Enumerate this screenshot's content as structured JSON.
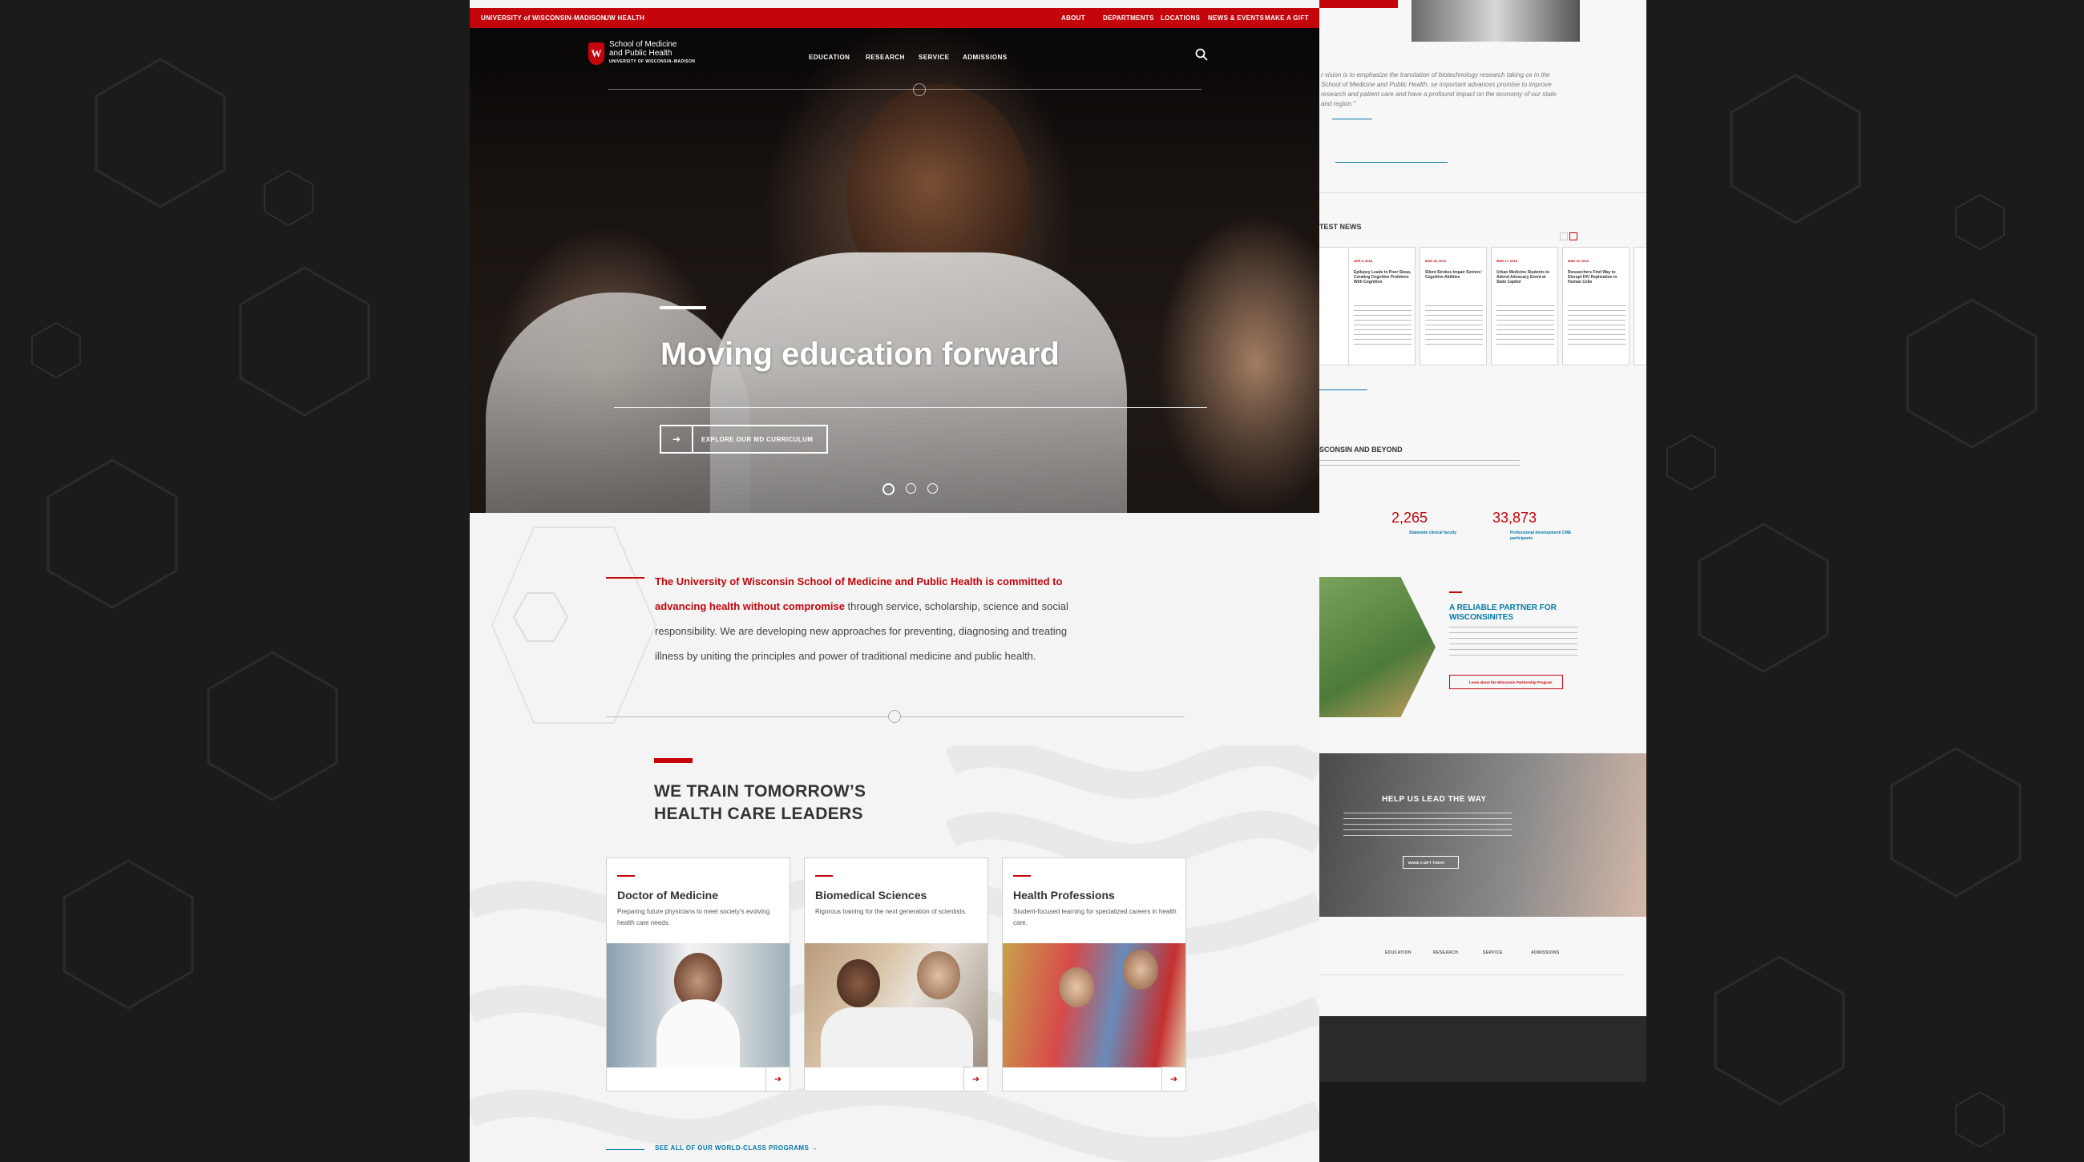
{
  "topbar": {
    "uw_madison": "UNIVERSITY of WISCONSIN-MADISON",
    "uw_health": "UW HEALTH",
    "links": [
      "ABOUT",
      "DEPARTMENTS",
      "LOCATIONS",
      "NEWS & EVENTS",
      "MAKE A GIFT"
    ]
  },
  "logo": {
    "line1": "School of Medicine",
    "line2": "and Public Health",
    "sub": "UNIVERSITY OF WISCONSIN–MADISON",
    "crest_letter": "W"
  },
  "nav": [
    "EDUCATION",
    "RESEARCH",
    "SERVICE",
    "ADMISSIONS"
  ],
  "hero": {
    "title": "Moving education forward",
    "button": "EXPLORE OUR MD CURRICULUM",
    "active_slide": 1,
    "slide_count": 3
  },
  "intro": {
    "highlight": "The University of Wisconsin School of Medicine and Public Health is committed to advancing health without compromise",
    "rest": " through service, scholarship, science and social responsibility. We are developing new approaches for preventing, diagnosing and treating illness by uniting the principles and power of traditional medicine and public health."
  },
  "training": {
    "title_line1": "WE TRAIN TOMORROW’S",
    "title_line2": "HEALTH CARE LEADERS",
    "cards": [
      {
        "title": "Doctor of Medicine",
        "desc": "Preparing future physicians to meet society’s evolving health care needs."
      },
      {
        "title": "Biomedical Sciences",
        "desc": "Rigorous training for the next generation of scientists."
      },
      {
        "title": "Health Professions",
        "desc": "Student-focused learning for specialized careers in health care."
      }
    ],
    "see_all": "SEE ALL OF OUR WORLD-CLASS PROGRAMS →"
  },
  "side": {
    "quote": "r vision is to emphasize the translation of biotechnology research taking ce in the School of Medicine and Public Health. se important advances promise to improve research and patient care and have a profound impact on the economy of our state and region.\"",
    "latest_news": "TEST NEWS",
    "news": [
      {
        "date": "APR 9, 2018",
        "title": "Epilepsy Leads to Poor Sleep, Creating Cognitive Problems With Cognition"
      },
      {
        "date": "MAR 28, 2018",
        "title": "Silent Strokes Impair Seniors’ Cognitive Abilities"
      },
      {
        "date": "MAR 27, 2018",
        "title": "Urban Medicine Students to Attend Advocacy Event at State Capitol"
      },
      {
        "date": "MAR 19, 2018",
        "title": "Researchers Find Way to Disrupt HIV Replication in Human Cells"
      }
    ],
    "wisconsin": "SCONSIN AND BEYOND",
    "stats": [
      {
        "value": "2,265",
        "label": "Statewide clinical faculty"
      },
      {
        "value": "33,873",
        "label": "Professional development/ CME participants"
      }
    ],
    "partner_title_1": "A RELIABLE PARTNER FOR",
    "partner_title_2": "WISCONSINITES",
    "partner_btn": "Learn about the Wisconsin Partnership Program",
    "lead_title": "HELP US LEAD THE WAY",
    "lead_btn": "MAKE A GIFT TODAY",
    "footer_nav": [
      "EDUCATION",
      "RESEARCH",
      "SERVICE",
      "ADMISSIONS"
    ]
  },
  "colors": {
    "brand_red": "#c5050c",
    "link_blue": "#0479a8",
    "page_bg": "#f4f4f4",
    "backdrop": "#1b1b1b"
  }
}
